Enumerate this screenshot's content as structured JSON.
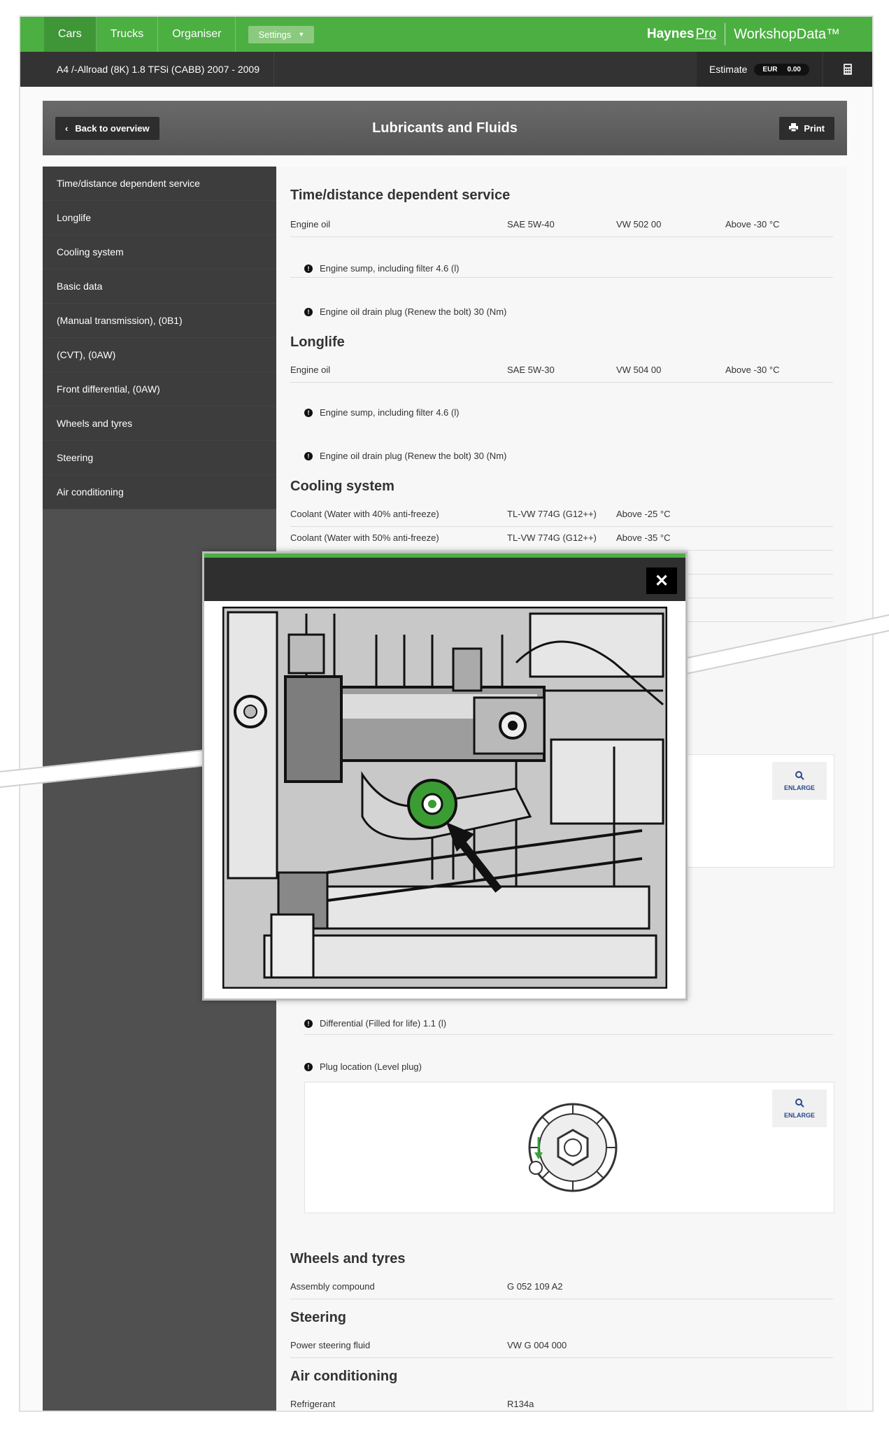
{
  "nav": {
    "tabs": [
      "Cars",
      "Trucks",
      "Organiser"
    ],
    "settings_label": "Settings",
    "brand_haynes": "Haynes",
    "brand_pro": "Pro",
    "brand_workshop": "WorkshopData™"
  },
  "vehicle": "A4 /-Allroad (8K) 1.8 TFSi (CABB) 2007 - 2009",
  "estimate": {
    "label": "Estimate",
    "currency": "EUR",
    "amount": "0.00"
  },
  "header": {
    "back_label": "Back to overview",
    "title": "Lubricants and Fluids",
    "print_label": "Print"
  },
  "sidebar": {
    "items": [
      "Time/distance dependent service",
      "Longlife",
      "Cooling system",
      "Basic data",
      "(Manual transmission), (0B1)",
      "(CVT), (0AW)",
      "Front differential, (0AW)",
      "Wheels and tyres",
      "Steering",
      "Air conditioning"
    ]
  },
  "sections": {
    "tds": {
      "title": "Time/distance dependent service",
      "row": [
        "Engine oil",
        "SAE 5W-40",
        "VW 502 00",
        "Above -30 °C"
      ],
      "note1": "Engine sump, including filter 4.6 (l)",
      "note2": "Engine oil drain plug  (Renew the bolt) 30 (Nm)"
    },
    "longlife": {
      "title": "Longlife",
      "row": [
        "Engine oil",
        "SAE 5W-30",
        "VW 504 00",
        "Above -30 °C"
      ],
      "note1": "Engine sump, including filter 4.6 (l)",
      "note2": "Engine oil drain plug  (Renew the bolt) 30 (Nm)"
    },
    "cooling": {
      "title": "Cooling system",
      "row1": [
        "Coolant (Water with 40% anti-freeze)",
        "TL-VW 774G (G12++)",
        "Above -25 °C"
      ],
      "row2": [
        "Coolant (Water with 50% anti-freeze)",
        "TL-VW 774G (G12++)",
        "Above -35 °C"
      ]
    },
    "diff": {
      "note1": "Differential  (Filled for life) 1.1 (l)",
      "note2": "Plug location  (Level plug)"
    },
    "wheels": {
      "title": "Wheels and tyres",
      "row": [
        "Assembly compound",
        "G 052 109 A2"
      ]
    },
    "steering": {
      "title": "Steering",
      "row": [
        "Power steering fluid",
        "VW G 004 000"
      ]
    },
    "aircon": {
      "title": "Air conditioning",
      "row": [
        "Refrigerant",
        "R134a"
      ]
    }
  },
  "enlarge_label": "ENLARGE",
  "modal": {
    "close_glyph": "✕"
  }
}
